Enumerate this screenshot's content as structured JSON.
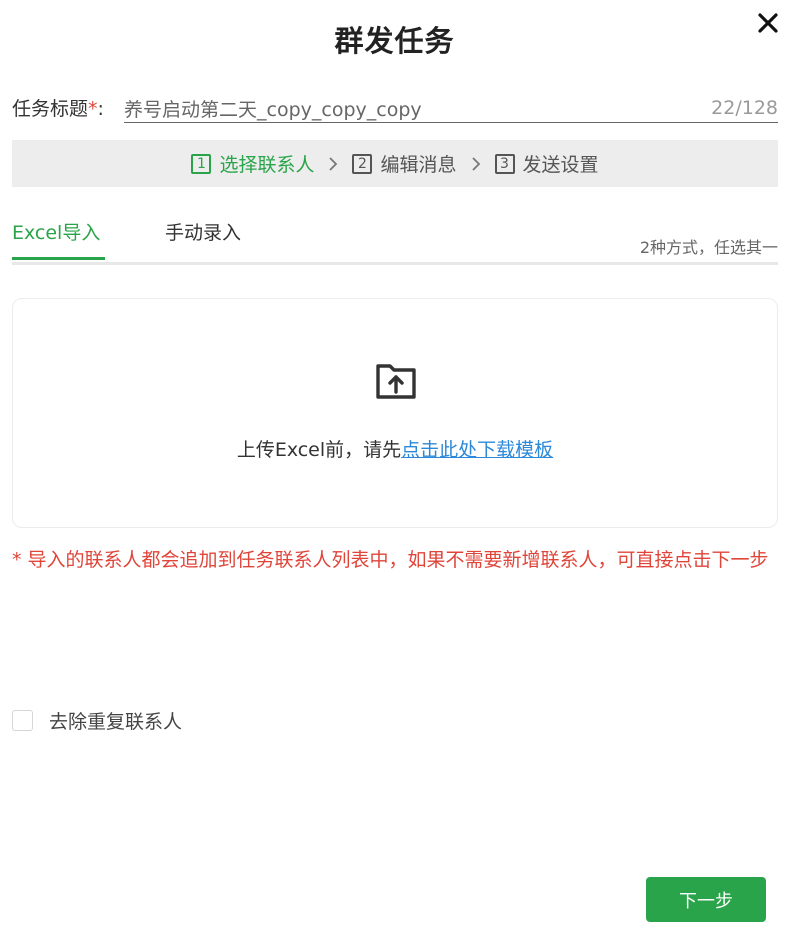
{
  "dialog": {
    "title": "群发任务"
  },
  "task": {
    "label": "任务标题",
    "required_mark": "*",
    "colon": ":",
    "value": "养号启动第二天_copy_copy_copy",
    "count": "22/128"
  },
  "steps": [
    {
      "num": "1",
      "label": "选择联系人",
      "active": true
    },
    {
      "num": "2",
      "label": "编辑消息",
      "active": false
    },
    {
      "num": "3",
      "label": "发送设置",
      "active": false
    }
  ],
  "tabs": {
    "items": [
      {
        "label": "Excel导入",
        "active": true
      },
      {
        "label": "手动录入",
        "active": false
      }
    ],
    "hint": "2种方式，任选其一"
  },
  "upload": {
    "icon": "folder-upload-icon",
    "text_prefix": "上传Excel前，请先",
    "link_text": "点击此处下载模板"
  },
  "warning": "* 导入的联系人都会追加到任务联系人列表中，如果不需要新增联系人，可直接点击下一步",
  "dedup": {
    "label": "去除重复联系人",
    "checked": false
  },
  "footer": {
    "next_label": "下一步"
  },
  "colors": {
    "accent": "#2aa44a",
    "link": "#2c88d9",
    "danger": "#e0453a",
    "steps_bg": "#ededed"
  }
}
